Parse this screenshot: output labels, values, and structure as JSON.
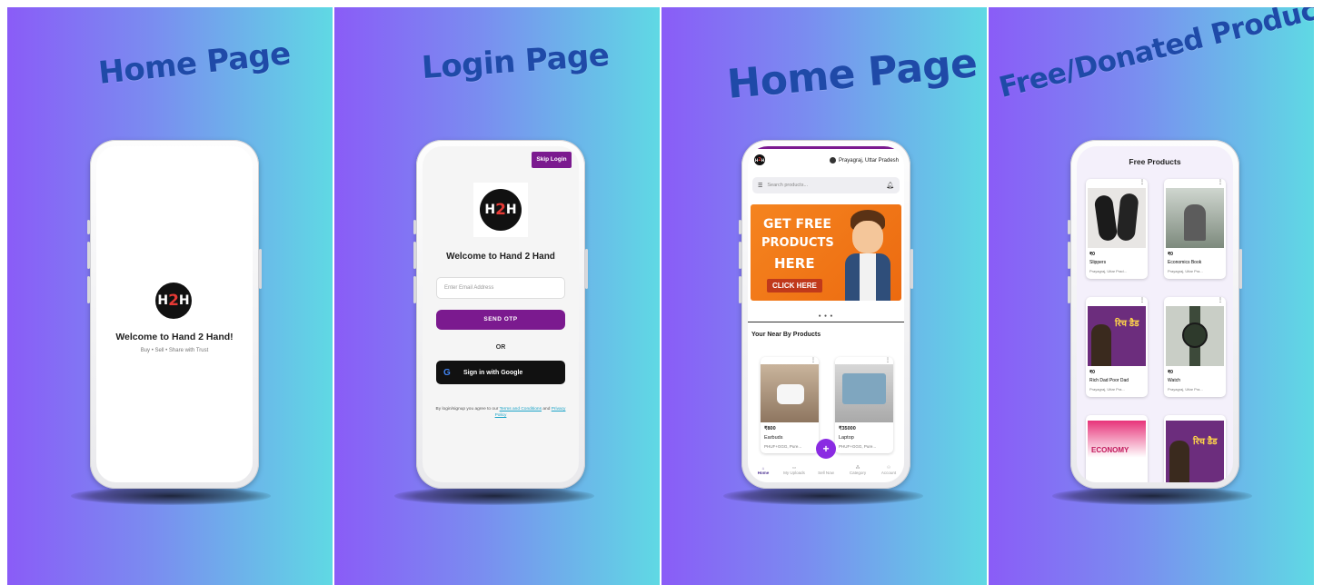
{
  "panels": {
    "p1": {
      "title": "Home Page"
    },
    "p2": {
      "title": "Login Page"
    },
    "p3": {
      "title": "Home Page"
    },
    "p4": {
      "title": "Free/Donated Products"
    }
  },
  "splash": {
    "welcome": "Welcome to Hand 2 Hand!",
    "tagline": "Buy • Sell • Share with Trust"
  },
  "login": {
    "skip_label": "Skip Login",
    "welcome": "Welcome to Hand 2 Hand",
    "email_placeholder": "Enter Email Address",
    "send_otp_label": "SEND OTP",
    "or_label": "OR",
    "google_label": "Sign in with Google",
    "terms_prefix": "By login/signup you agree to our",
    "terms_link": "Terms and Conditions",
    "and_label": "and",
    "privacy_link": "Privacy Policy"
  },
  "home": {
    "location": "Prayagraj, Uttar Pradesh",
    "search_placeholder": "Search products...",
    "banner": {
      "line1": "GET FREE",
      "line2": "PRODUCTS",
      "line3": "HERE",
      "cta": "CLICK HERE"
    },
    "section_title": "Your Near By Products",
    "products": [
      {
        "price": "₹800",
        "name": "Earbuds",
        "location": "PHUF+GGG, Pure..."
      },
      {
        "price": "₹35000",
        "name": "Laptop",
        "location": "PHUF+GGG, Pure..."
      }
    ],
    "fab": "+",
    "nav": [
      "Home",
      "My Uploads",
      "Sell Now",
      "Category",
      "Account"
    ]
  },
  "free": {
    "title": "Free Products",
    "items": [
      {
        "price": "₹0",
        "name": "Slippers",
        "location": "Prayagraj, Uttar Prad..."
      },
      {
        "price": "₹0",
        "name": "Economics Book",
        "location": "Prayagraj, Uttar Pra..."
      },
      {
        "price": "₹0",
        "name": "Rich Dad Poor Dad",
        "location": "Prayagraj, Uttar Pra..."
      },
      {
        "price": "₹0",
        "name": "Watch",
        "location": "Prayagraj, Uttar Pra..."
      }
    ],
    "book_cover_text": "ECONOMY",
    "hindi_book_text": "रिच डैड"
  },
  "logo": {
    "h": "H",
    "two": "2",
    "h2": "H"
  },
  "colors": {
    "purple": "#8a5cf7",
    "cyan": "#5fd9e4",
    "title_blue": "#1f4aa8",
    "brand_purple": "#7b1a8f",
    "banner_orange": "#f07a16"
  }
}
